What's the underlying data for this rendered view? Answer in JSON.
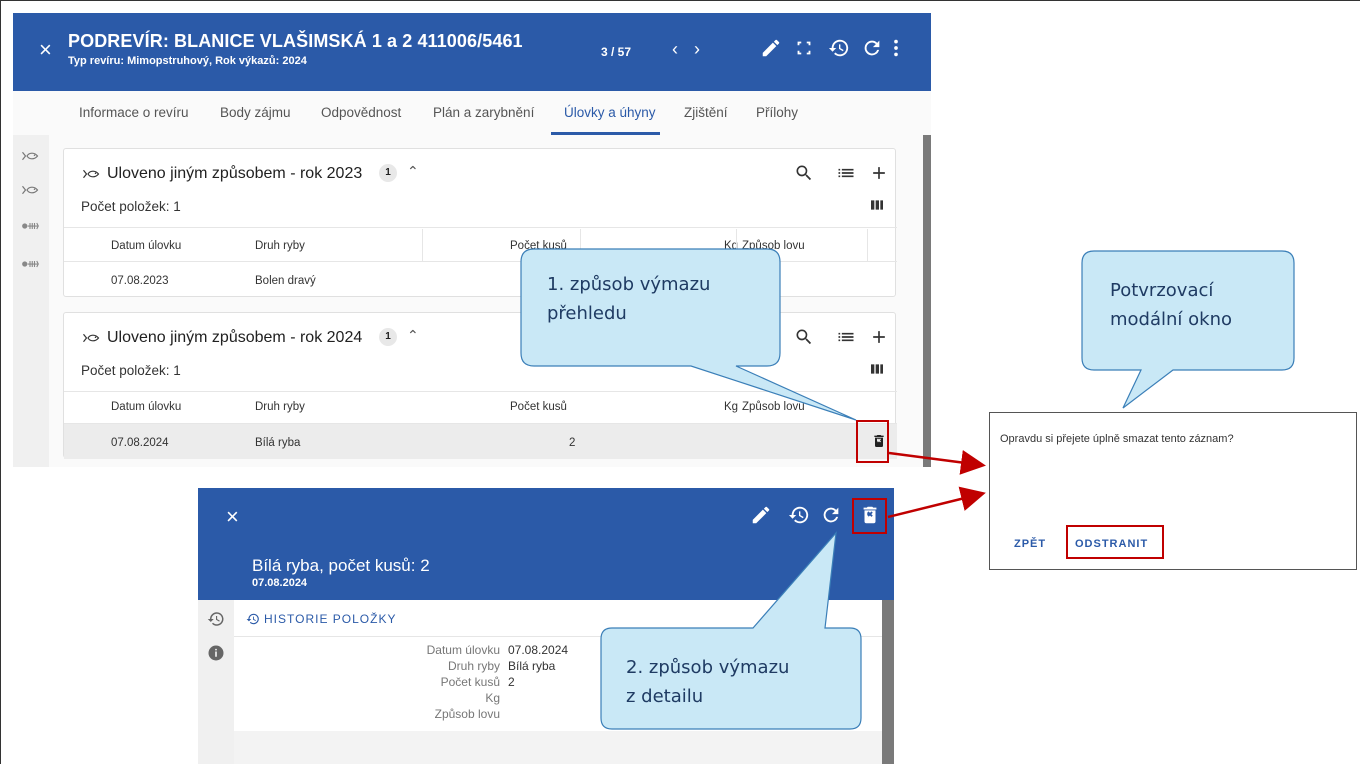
{
  "top": {
    "close_icon": "×",
    "title": "PODREVÍR: BLANICE VLAŠIMSKÁ 1 a 2 411006/5461",
    "subtitle": "Typ revíru: Mimopstruhový, Rok výkazů: 2024",
    "pager": "3 / 57",
    "prev": "‹",
    "next": "›",
    "tabs": [
      "Informace o revíru",
      "Body zájmu",
      "Odpovědnost",
      "Plán a zarybnění",
      "Úlovky a úhyny",
      "Zjištění",
      "Přílohy"
    ]
  },
  "sections": [
    {
      "title": "Uloveno jiným způsobem - rok 2023",
      "badge": "1",
      "count": "Počet položek: 1",
      "columns": [
        "Datum úlovku",
        "Druh ryby",
        "Počet kusů",
        "Kg",
        "Způsob lovu"
      ],
      "row": [
        "07.08.2023",
        "Bolen dravý"
      ]
    },
    {
      "title": "Uloveno jiným způsobem - rok 2024",
      "badge": "1",
      "count": "Počet položek: 1",
      "columns": [
        "Datum úlovku",
        "Druh ryby",
        "Počet kusů",
        "Kg",
        "Způsob lovu"
      ],
      "row": [
        "07.08.2024",
        "Bílá ryba",
        "2"
      ]
    }
  ],
  "detail": {
    "close_icon": "×",
    "title": "Bílá ryba, počet kusů: 2",
    "date": "07.08.2024",
    "history_title": "HISTORIE POLOŽKY",
    "fields": [
      {
        "label": "Datum úlovku",
        "value": "07.08.2024"
      },
      {
        "label": "Druh ryby",
        "value": "Bílá ryba"
      },
      {
        "label": "Počet kusů",
        "value": "2"
      },
      {
        "label": "Kg",
        "value": ""
      },
      {
        "label": "Způsob lovu",
        "value": ""
      }
    ]
  },
  "modal": {
    "text": "Opravdu si přejete úplně smazat tento záznam?",
    "back": "ZPĚT",
    "remove": "ODSTRANIT"
  },
  "callouts": {
    "c1_line1": "1. způsob výmazu",
    "c1_line2": "přehledu",
    "c2_line1": "Potvrzovací",
    "c2_line2": "modální okno",
    "c3_line1": "2. způsob výmazu",
    "c3_line2": "z detailu"
  },
  "colors": {
    "primary": "#2b5aa8",
    "callout_fill": "#c9e8f6",
    "callout_border": "#3b7fb8",
    "highlight": "#c00000"
  }
}
